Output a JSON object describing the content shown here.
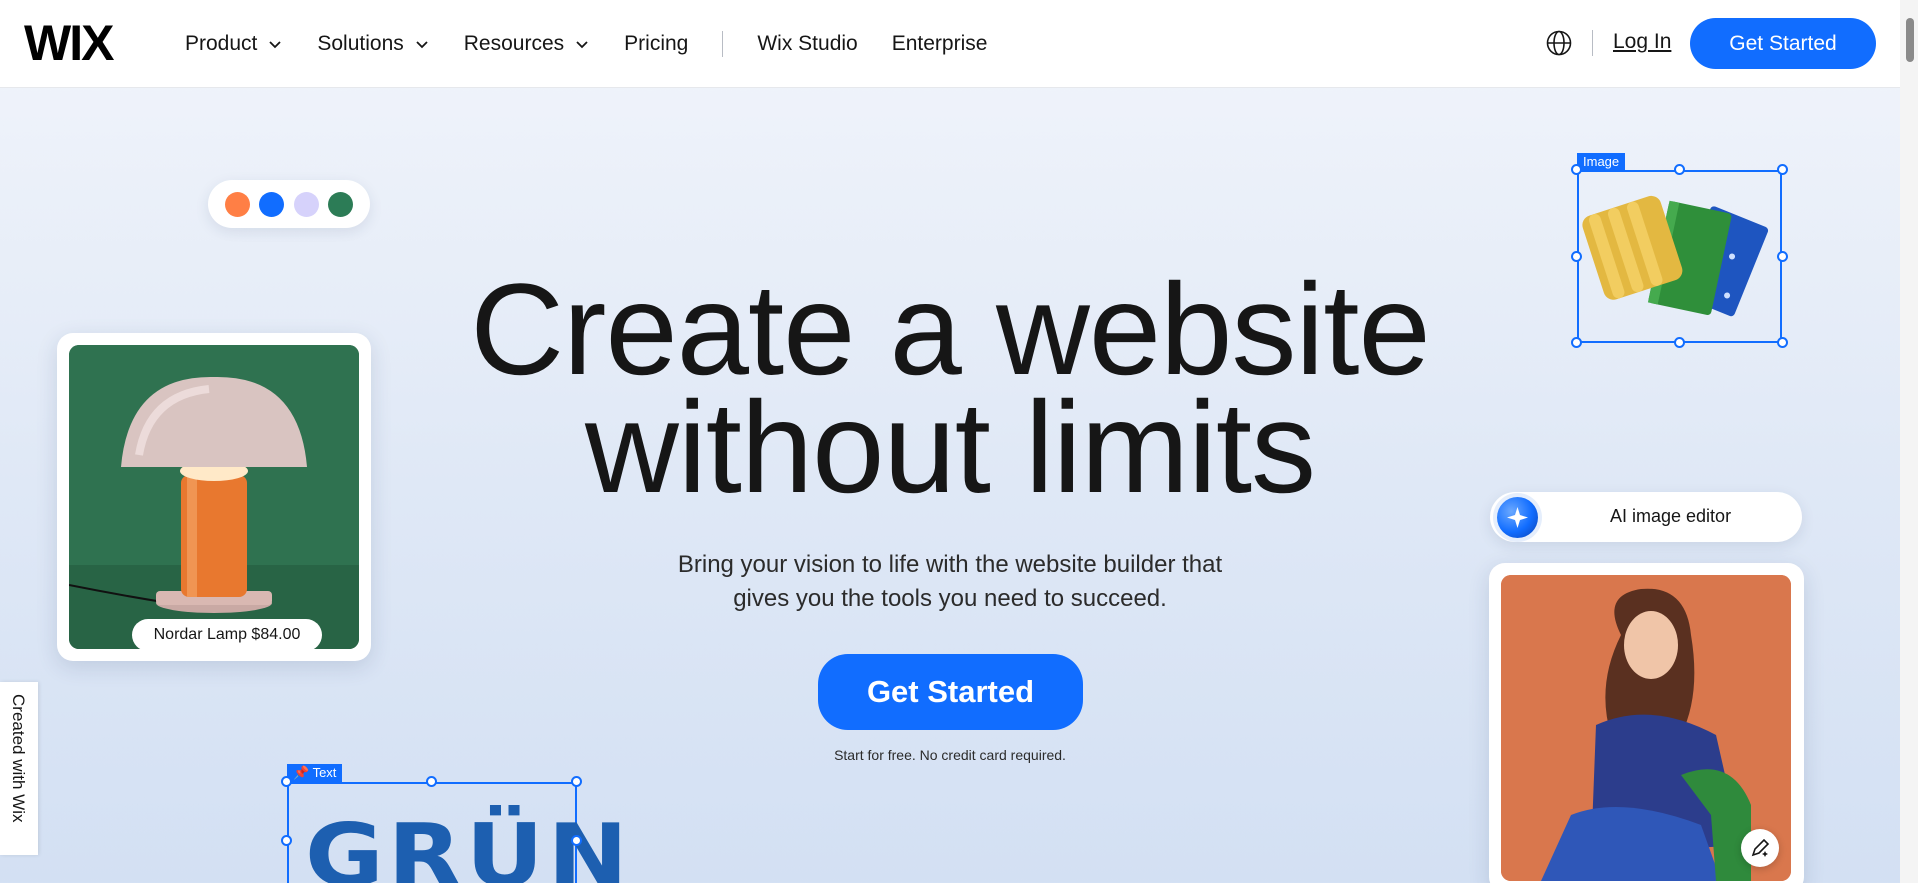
{
  "header": {
    "logo": "WIX",
    "nav": [
      {
        "label": "Product",
        "has_dropdown": true
      },
      {
        "label": "Solutions",
        "has_dropdown": true
      },
      {
        "label": "Resources",
        "has_dropdown": true
      },
      {
        "label": "Pricing",
        "has_dropdown": false
      }
    ],
    "nav_secondary": [
      {
        "label": "Wix Studio"
      },
      {
        "label": "Enterprise"
      }
    ],
    "language_icon": "globe-icon",
    "login_label": "Log In",
    "cta_label": "Get Started"
  },
  "hero": {
    "title_line1": "Create a website",
    "title_line2": "without limits",
    "subtitle_line1": "Bring your vision to life with the website builder that",
    "subtitle_line2": "gives you the tools you need to succeed.",
    "cta_label": "Get Started",
    "note": "Start for free. No credit card required."
  },
  "decor": {
    "swatch_colors": [
      "#ff7f45",
      "#116dff",
      "#d6d2fb",
      "#2c7c56"
    ],
    "lamp_badge": "Nordar Lamp $84.00",
    "image_tag": "Image",
    "ai_pill_label": "AI image editor",
    "text_tag": "Text",
    "grun_text": "GRÜN",
    "edit_icon": "pencil-sparkle-icon"
  },
  "side_tab": {
    "label": "Created with Wix"
  },
  "colors": {
    "accent": "#116dff",
    "text": "#161616"
  }
}
